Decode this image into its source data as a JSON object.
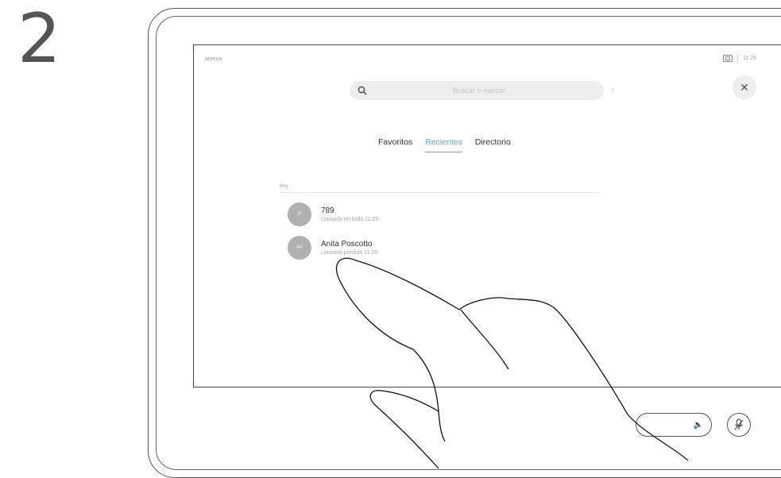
{
  "step_number": "2",
  "screen": {
    "top_left_label": "acerca",
    "clock": "11:26",
    "search": {
      "placeholder": "Buscar o marcar"
    },
    "tabs": [
      {
        "label": "Favoritos",
        "active": false
      },
      {
        "label": "Recientes",
        "active": true
      },
      {
        "label": "Directorio",
        "active": false
      }
    ],
    "list_header": "Hoy",
    "recents": [
      {
        "name": "789",
        "detail": "Llamada recibida 11:26",
        "avatar": "P"
      },
      {
        "name": "Anita Poscotto",
        "detail": "Llamada perdida 11:26",
        "avatar": "AP"
      }
    ]
  },
  "colors": {
    "accent": "#4fb3d9"
  },
  "icons": {
    "search": "magnifier",
    "close": "x",
    "volume": "speaker",
    "mute": "mic-off",
    "camera": "self-view"
  }
}
